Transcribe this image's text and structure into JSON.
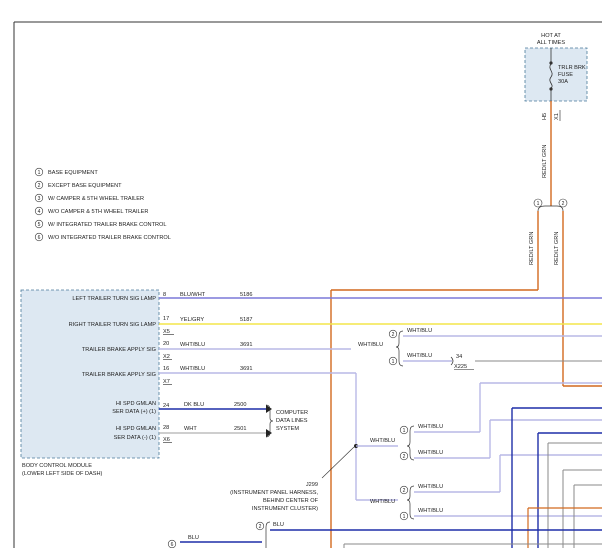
{
  "hot_label": [
    "HOT AT",
    "ALL TIMES"
  ],
  "fuse": {
    "lines": [
      "TRLR BRK",
      "FUSE",
      "30A"
    ],
    "pin": "X1",
    "cavity": "H5"
  },
  "legend": [
    {
      "num": "1",
      "text": "BASE EQUIPMENT"
    },
    {
      "num": "2",
      "text": "EXCEPT BASE EQUIPMENT"
    },
    {
      "num": "3",
      "text": "W/ CAMPER & 5TH WHEEL TRAILER"
    },
    {
      "num": "4",
      "text": "W/O CAMPER & 5TH WHEEL TRAILER"
    },
    {
      "num": "5",
      "text": "W/ INTEGRATED TRAILER BRAKE CONTROL"
    },
    {
      "num": "6",
      "text": "W/O INTEGRATED TRAILER BRAKE CONTROL"
    }
  ],
  "feed_wire_upper": "RED/LT GRN",
  "feed_wire_left": "RED/LT GRN",
  "feed_wire_right": "RED/LT GRN",
  "feed_split": [
    "1",
    "2"
  ],
  "bcm": {
    "name": "BODY CONTROL MODULE",
    "location": "(LOWER LEFT SIDE OF DASH)",
    "pins": [
      {
        "label": "LEFT TRAILER TURN SIG LAMP",
        "pin": "8",
        "wire": "BLU/WHT",
        "circuit": "5186",
        "connector": ""
      },
      {
        "label": "RIGHT TRAILER TURN SIG LAMP",
        "pin": "17",
        "wire": "YEL/GRY",
        "circuit": "5187",
        "connector": "X5"
      },
      {
        "label": "TRAILER BRAKE APPLY SIG",
        "pin": "20",
        "wire": "WHT/BLU",
        "circuit": "3691",
        "connector": "X2"
      },
      {
        "label": "TRAILER BRAKE APPLY SIG",
        "pin": "16",
        "wire": "WHT/BLU",
        "circuit": "3691",
        "connector": "X7"
      },
      {
        "label": "HI SPD GMLAN SER DATA (+) (1)",
        "pin": "24",
        "wire": "DK BLU",
        "circuit": "2500",
        "connector": ""
      },
      {
        "label": "HI SPD GMLAN SER DATA (-) (1)",
        "pin": "28",
        "wire": "WHT",
        "circuit": "2501",
        "connector": "X6"
      }
    ]
  },
  "computer_data": [
    "COMPUTER",
    "DATA LINES",
    "SYSTEM"
  ],
  "splice": {
    "id": "J299",
    "desc": [
      "(INSTRUMENT PANEL HARNESS,",
      "BEHIND CENTER OF",
      "INSTRUMENT CLUSTER)"
    ]
  },
  "branches": {
    "b1": {
      "wire": "WHT/BLU",
      "opts": [
        "2",
        "1"
      ],
      "wires": [
        "WHT/BLU",
        "WHT/BLU"
      ],
      "pin": "34",
      "connector": "X225"
    },
    "b2": {
      "wire": "WHT/BLU",
      "opts": [
        "1",
        "2"
      ],
      "wires": [
        "WHT/BLU",
        "WHT/BLU"
      ]
    },
    "b3": {
      "wire": "WHT/BLU",
      "opts": [
        "2",
        "1"
      ],
      "wires": [
        "WHT/BLU",
        "WHT/BLU"
      ]
    },
    "b4": {
      "opt": "2",
      "wire": "BLU"
    },
    "b5": {
      "opt": "6",
      "wire": "BLU"
    }
  },
  "colors": {
    "red_lt_grn": "#d2691e",
    "blu_wht": "#7b79d8",
    "yel_gry": "#f4e64a",
    "wht_blu": "#b8b8e6",
    "dk_blu": "#1f2fa8",
    "gray": "#8a8a8a",
    "border": "#333333",
    "dashed": "#4a7a9a",
    "box_fill": "#dde8f2"
  }
}
